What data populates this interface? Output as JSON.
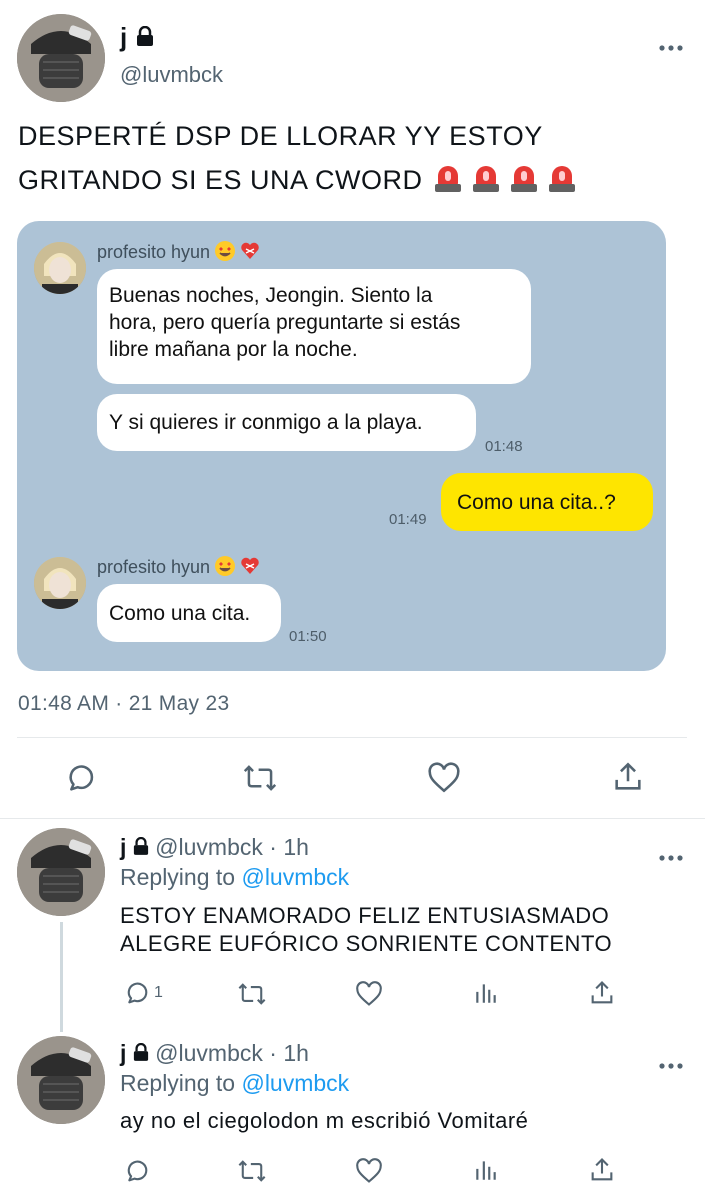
{
  "tweet": {
    "name": "j",
    "handle": "@luvmbck",
    "text_line1": "DESPERTÉ DSP DE LLORAR YY ESTOY",
    "text_line2": "GRITANDO SI ES UNA CWORD",
    "timestamp": "01:48 AM · 21 May 23"
  },
  "chat": {
    "sender_name": "profesito hyun",
    "messages": [
      {
        "from": "profesito hyun",
        "text_lines": [
          "Buenas noches, Jeongin. Siento la",
          "hora, pero quería preguntarte si estás",
          "libre mañana por la noche."
        ]
      },
      {
        "from": "profesito hyun",
        "text": "Y si quieres ir conmigo a la playa.",
        "time": "01:48"
      },
      {
        "from": "me",
        "text": "Como una cita..?",
        "time": "01:49"
      },
      {
        "from": "profesito hyun",
        "text": "Como una cita.",
        "time": "01:50"
      }
    ]
  },
  "replies": [
    {
      "name": "j",
      "handle": "@luvmbck",
      "age": "· 1h",
      "replying_label": "Replying to",
      "replying_to": "@luvmbck",
      "text_line1": "ESTOY ENAMORADO FELIZ ENTUSIASMADO",
      "text_line2": "ALEGRE EUFÓRICO SONRIENTE CONTENTO",
      "reply_count": "1"
    },
    {
      "name": "j",
      "handle": "@luvmbck",
      "age": "· 1h",
      "replying_label": "Replying to",
      "replying_to": "@luvmbck",
      "text_line1": "ay no el ciegolodon m escribió Vomitaré"
    }
  ],
  "icons": [
    "lock-icon",
    "more-icon",
    "reply-icon",
    "retweet-icon",
    "like-icon",
    "share-icon",
    "views-icon",
    "siren-emoji",
    "heart-eyes-emoji",
    "mending-heart-emoji"
  ],
  "colors": {
    "link": "#1d9bf0",
    "muted": "#536471",
    "chat_bg": "#adc3d6",
    "yellow_bubble": "#fee500"
  }
}
